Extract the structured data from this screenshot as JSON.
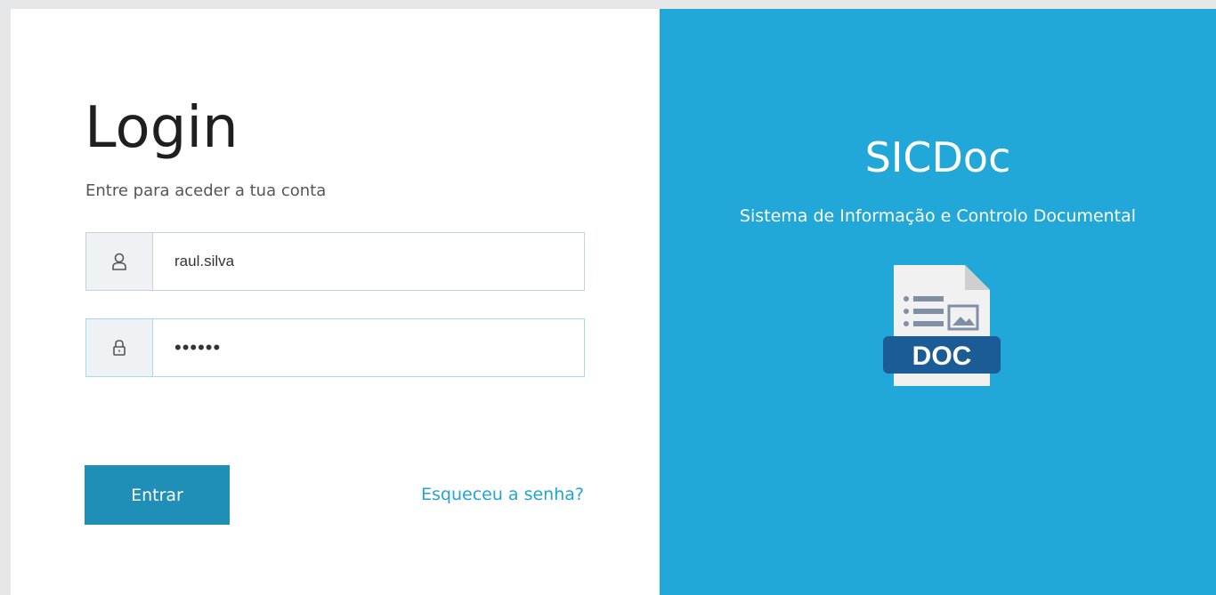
{
  "login": {
    "title": "Login",
    "subtitle": "Entre para aceder a tua conta",
    "username": {
      "value": "raul.silva",
      "icon": "user-icon"
    },
    "password": {
      "value": "••••••",
      "icon": "lock-icon"
    },
    "submit_label": "Entrar",
    "forgot_label": "Esqueceu a senha?"
  },
  "brand": {
    "name": "SICDoc",
    "tagline": "Sistema de Informação e Controlo Documental",
    "logo_label": "DOC",
    "logo_icon": "doc-file-icon"
  },
  "colors": {
    "accent": "#22a8d8",
    "button": "#1f8fb8",
    "link": "#23a3d0"
  }
}
